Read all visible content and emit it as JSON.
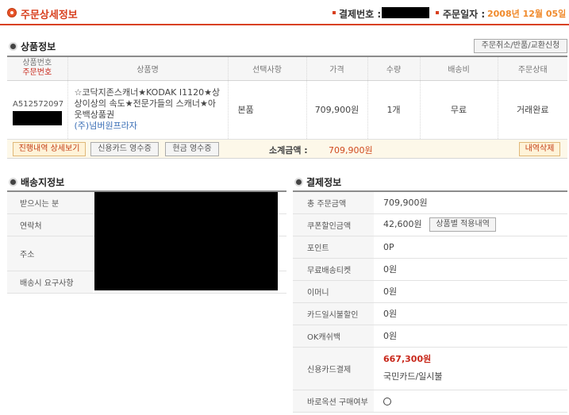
{
  "header": {
    "title": "주문상세정보",
    "payment_no_label": "결제번호 :",
    "order_date_label": "주문일자 :",
    "order_date": "2008년 12월 05일"
  },
  "product_section": {
    "title": "상품정보",
    "action_button": "주문취소/반품/교환신청",
    "columns": {
      "product_no": "상품번호",
      "order_no": "주문번호",
      "name": "상품명",
      "option": "선택사항",
      "price": "가격",
      "qty": "수량",
      "shipping": "배송비",
      "status": "주문상태"
    },
    "row": {
      "product_no": "A512572097",
      "name": "☆코닥지존스캐너★KODAK I1120★상상이상의 속도★전문가들의 스캐너★아웃백상품권",
      "shop": "(주)넘버원프라자",
      "option": "본품",
      "price": "709,900원",
      "qty": "1개",
      "shipping": "무료",
      "status": "거래완료"
    },
    "buttons": {
      "progress": "진행내역 상세보기",
      "card_receipt": "신용카드 영수증",
      "cash_receipt": "현금 영수증",
      "delete": "내역삭제"
    },
    "subtotal_label": "소계금액 :",
    "subtotal_value": "709,900원"
  },
  "delivery_section": {
    "title": "배송지정보",
    "rows": [
      "받으시는 분",
      "연락처",
      "주소",
      "배송시 요구사항"
    ]
  },
  "payment_section": {
    "title": "결제정보",
    "rows": {
      "total_label": "총 주문금액",
      "total_value": "709,900원",
      "coupon_label": "쿠폰할인금액",
      "coupon_value": "42,600원",
      "coupon_button": "상품별 적용내역",
      "point_label": "포인트",
      "point_value": "0P",
      "free_ticket_label": "무료배송티켓",
      "free_ticket_value": "0원",
      "emoney_label": "이머니",
      "emoney_value": "0원",
      "card_discount_label": "카드일시불할인",
      "card_discount_value": "0원",
      "okcash_label": "OK캐쉬백",
      "okcash_value": "0원",
      "card_pay_label": "신용카드결제",
      "card_pay_value": "667,300원",
      "card_pay_detail": "국민카드/일시불",
      "direct_label": "바로옥션 구매여부"
    }
  }
}
